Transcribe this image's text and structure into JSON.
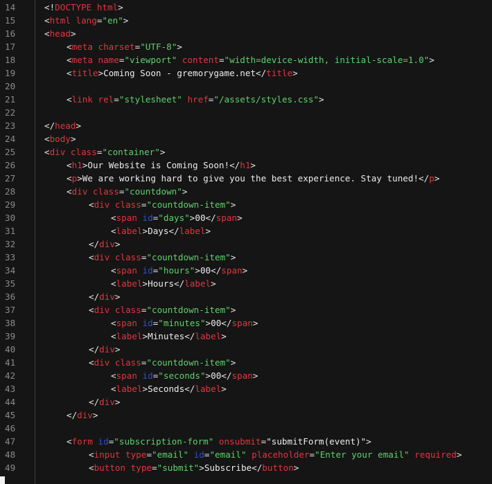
{
  "editor": {
    "background": "#151515",
    "colors": {
      "line_number": "#8b8b8b",
      "punctuation": "#e6e6e6",
      "tag": "#e0363f",
      "attribute": "#e0363f",
      "id_attribute": "#2a52c9",
      "string": "#5fd16b",
      "text": "#ececec"
    },
    "lines": [
      {
        "n": "14",
        "indent": 0,
        "tokens": [
          {
            "t": "<!",
            "k": "punct"
          },
          {
            "t": "DOCTYPE",
            "k": "tag"
          },
          {
            "t": " html",
            "k": "attr"
          },
          {
            "t": ">",
            "k": "punct"
          }
        ]
      },
      {
        "n": "15",
        "indent": 0,
        "tokens": [
          {
            "t": "<",
            "k": "punct"
          },
          {
            "t": "html",
            "k": "tag"
          },
          {
            "t": " lang",
            "k": "attr"
          },
          {
            "t": "=",
            "k": "punct"
          },
          {
            "t": "\"en\"",
            "k": "str"
          },
          {
            "t": ">",
            "k": "punct"
          }
        ]
      },
      {
        "n": "16",
        "indent": 0,
        "tokens": [
          {
            "t": "<",
            "k": "punct"
          },
          {
            "t": "head",
            "k": "tag"
          },
          {
            "t": ">",
            "k": "punct"
          }
        ]
      },
      {
        "n": "17",
        "indent": 1,
        "tokens": [
          {
            "t": "<",
            "k": "punct"
          },
          {
            "t": "meta",
            "k": "tag"
          },
          {
            "t": " charset",
            "k": "attr"
          },
          {
            "t": "=",
            "k": "punct"
          },
          {
            "t": "\"UTF-8\"",
            "k": "str"
          },
          {
            "t": ">",
            "k": "punct"
          }
        ]
      },
      {
        "n": "18",
        "indent": 1,
        "tokens": [
          {
            "t": "<",
            "k": "punct"
          },
          {
            "t": "meta",
            "k": "tag"
          },
          {
            "t": " name",
            "k": "attr"
          },
          {
            "t": "=",
            "k": "punct"
          },
          {
            "t": "\"viewport\"",
            "k": "str"
          },
          {
            "t": " content",
            "k": "attr"
          },
          {
            "t": "=",
            "k": "punct"
          },
          {
            "t": "\"width=device-width, initial-scale=1.0\"",
            "k": "str"
          },
          {
            "t": ">",
            "k": "punct"
          }
        ]
      },
      {
        "n": "19",
        "indent": 1,
        "tokens": [
          {
            "t": "<",
            "k": "punct"
          },
          {
            "t": "title",
            "k": "tag"
          },
          {
            "t": ">",
            "k": "punct"
          },
          {
            "t": "Coming Soon - gremorygame.net",
            "k": "text"
          },
          {
            "t": "</",
            "k": "punct"
          },
          {
            "t": "title",
            "k": "tag"
          },
          {
            "t": ">",
            "k": "punct"
          }
        ]
      },
      {
        "n": "20",
        "indent": 0,
        "tokens": []
      },
      {
        "n": "21",
        "indent": 1,
        "tokens": [
          {
            "t": "<",
            "k": "punct"
          },
          {
            "t": "link",
            "k": "tag"
          },
          {
            "t": " rel",
            "k": "attr"
          },
          {
            "t": "=",
            "k": "punct"
          },
          {
            "t": "\"stylesheet\"",
            "k": "str"
          },
          {
            "t": " href",
            "k": "attr"
          },
          {
            "t": "=",
            "k": "punct"
          },
          {
            "t": "\"/assets/styles.css\"",
            "k": "str"
          },
          {
            "t": ">",
            "k": "punct"
          }
        ]
      },
      {
        "n": "22",
        "indent": 0,
        "tokens": []
      },
      {
        "n": "23",
        "indent": 0,
        "tokens": [
          {
            "t": "</",
            "k": "punct"
          },
          {
            "t": "head",
            "k": "tag"
          },
          {
            "t": ">",
            "k": "punct"
          }
        ]
      },
      {
        "n": "24",
        "indent": 0,
        "tokens": [
          {
            "t": "<",
            "k": "punct"
          },
          {
            "t": "body",
            "k": "tag"
          },
          {
            "t": ">",
            "k": "punct"
          }
        ]
      },
      {
        "n": "25",
        "indent": 0,
        "tokens": [
          {
            "t": "<",
            "k": "punct"
          },
          {
            "t": "div",
            "k": "tag"
          },
          {
            "t": " class",
            "k": "attr"
          },
          {
            "t": "=",
            "k": "punct"
          },
          {
            "t": "\"container\"",
            "k": "str"
          },
          {
            "t": ">",
            "k": "punct"
          }
        ]
      },
      {
        "n": "26",
        "indent": 1,
        "tokens": [
          {
            "t": "<",
            "k": "punct"
          },
          {
            "t": "h1",
            "k": "tag"
          },
          {
            "t": ">",
            "k": "punct"
          },
          {
            "t": "Our Website is Coming Soon!",
            "k": "text"
          },
          {
            "t": "</",
            "k": "punct"
          },
          {
            "t": "h1",
            "k": "tag"
          },
          {
            "t": ">",
            "k": "punct"
          }
        ]
      },
      {
        "n": "27",
        "indent": 1,
        "tokens": [
          {
            "t": "<",
            "k": "punct"
          },
          {
            "t": "p",
            "k": "tag"
          },
          {
            "t": ">",
            "k": "punct"
          },
          {
            "t": "We are working hard to give you the best experience. Stay tuned!",
            "k": "text"
          },
          {
            "t": "</",
            "k": "punct"
          },
          {
            "t": "p",
            "k": "tag"
          },
          {
            "t": ">",
            "k": "punct"
          }
        ]
      },
      {
        "n": "28",
        "indent": 1,
        "tokens": [
          {
            "t": "<",
            "k": "punct"
          },
          {
            "t": "div",
            "k": "tag"
          },
          {
            "t": " class",
            "k": "attr"
          },
          {
            "t": "=",
            "k": "punct"
          },
          {
            "t": "\"countdown\"",
            "k": "str"
          },
          {
            "t": ">",
            "k": "punct"
          }
        ]
      },
      {
        "n": "29",
        "indent": 2,
        "tokens": [
          {
            "t": "<",
            "k": "punct"
          },
          {
            "t": "div",
            "k": "tag"
          },
          {
            "t": " class",
            "k": "attr"
          },
          {
            "t": "=",
            "k": "punct"
          },
          {
            "t": "\"countdown-item\"",
            "k": "str"
          },
          {
            "t": ">",
            "k": "punct"
          }
        ]
      },
      {
        "n": "30",
        "indent": 3,
        "tokens": [
          {
            "t": "<",
            "k": "punct"
          },
          {
            "t": "span",
            "k": "tag"
          },
          {
            "t": " id",
            "k": "attr-id"
          },
          {
            "t": "=",
            "k": "punct"
          },
          {
            "t": "\"days\"",
            "k": "str"
          },
          {
            "t": ">",
            "k": "punct"
          },
          {
            "t": "00",
            "k": "text"
          },
          {
            "t": "</",
            "k": "punct"
          },
          {
            "t": "span",
            "k": "tag"
          },
          {
            "t": ">",
            "k": "punct"
          }
        ]
      },
      {
        "n": "31",
        "indent": 3,
        "tokens": [
          {
            "t": "<",
            "k": "punct"
          },
          {
            "t": "label",
            "k": "tag"
          },
          {
            "t": ">",
            "k": "punct"
          },
          {
            "t": "Days",
            "k": "text"
          },
          {
            "t": "</",
            "k": "punct"
          },
          {
            "t": "label",
            "k": "tag"
          },
          {
            "t": ">",
            "k": "punct"
          }
        ]
      },
      {
        "n": "32",
        "indent": 2,
        "tokens": [
          {
            "t": "</",
            "k": "punct"
          },
          {
            "t": "div",
            "k": "tag"
          },
          {
            "t": ">",
            "k": "punct"
          }
        ]
      },
      {
        "n": "33",
        "indent": 2,
        "tokens": [
          {
            "t": "<",
            "k": "punct"
          },
          {
            "t": "div",
            "k": "tag"
          },
          {
            "t": " class",
            "k": "attr"
          },
          {
            "t": "=",
            "k": "punct"
          },
          {
            "t": "\"countdown-item\"",
            "k": "str"
          },
          {
            "t": ">",
            "k": "punct"
          }
        ]
      },
      {
        "n": "34",
        "indent": 3,
        "tokens": [
          {
            "t": "<",
            "k": "punct"
          },
          {
            "t": "span",
            "k": "tag"
          },
          {
            "t": " id",
            "k": "attr-id"
          },
          {
            "t": "=",
            "k": "punct"
          },
          {
            "t": "\"hours\"",
            "k": "str"
          },
          {
            "t": ">",
            "k": "punct"
          },
          {
            "t": "00",
            "k": "text"
          },
          {
            "t": "</",
            "k": "punct"
          },
          {
            "t": "span",
            "k": "tag"
          },
          {
            "t": ">",
            "k": "punct"
          }
        ]
      },
      {
        "n": "35",
        "indent": 3,
        "tokens": [
          {
            "t": "<",
            "k": "punct"
          },
          {
            "t": "label",
            "k": "tag"
          },
          {
            "t": ">",
            "k": "punct"
          },
          {
            "t": "Hours",
            "k": "text"
          },
          {
            "t": "</",
            "k": "punct"
          },
          {
            "t": "label",
            "k": "tag"
          },
          {
            "t": ">",
            "k": "punct"
          }
        ]
      },
      {
        "n": "36",
        "indent": 2,
        "tokens": [
          {
            "t": "</",
            "k": "punct"
          },
          {
            "t": "div",
            "k": "tag"
          },
          {
            "t": ">",
            "k": "punct"
          }
        ]
      },
      {
        "n": "37",
        "indent": 2,
        "tokens": [
          {
            "t": "<",
            "k": "punct"
          },
          {
            "t": "div",
            "k": "tag"
          },
          {
            "t": " class",
            "k": "attr"
          },
          {
            "t": "=",
            "k": "punct"
          },
          {
            "t": "\"countdown-item\"",
            "k": "str"
          },
          {
            "t": ">",
            "k": "punct"
          }
        ]
      },
      {
        "n": "38",
        "indent": 3,
        "tokens": [
          {
            "t": "<",
            "k": "punct"
          },
          {
            "t": "span",
            "k": "tag"
          },
          {
            "t": " id",
            "k": "attr-id"
          },
          {
            "t": "=",
            "k": "punct"
          },
          {
            "t": "\"minutes\"",
            "k": "str"
          },
          {
            "t": ">",
            "k": "punct"
          },
          {
            "t": "00",
            "k": "text"
          },
          {
            "t": "</",
            "k": "punct"
          },
          {
            "t": "span",
            "k": "tag"
          },
          {
            "t": ">",
            "k": "punct"
          }
        ]
      },
      {
        "n": "39",
        "indent": 3,
        "tokens": [
          {
            "t": "<",
            "k": "punct"
          },
          {
            "t": "label",
            "k": "tag"
          },
          {
            "t": ">",
            "k": "punct"
          },
          {
            "t": "Minutes",
            "k": "text"
          },
          {
            "t": "</",
            "k": "punct"
          },
          {
            "t": "label",
            "k": "tag"
          },
          {
            "t": ">",
            "k": "punct"
          }
        ]
      },
      {
        "n": "40",
        "indent": 2,
        "tokens": [
          {
            "t": "</",
            "k": "punct"
          },
          {
            "t": "div",
            "k": "tag"
          },
          {
            "t": ">",
            "k": "punct"
          }
        ]
      },
      {
        "n": "41",
        "indent": 2,
        "tokens": [
          {
            "t": "<",
            "k": "punct"
          },
          {
            "t": "div",
            "k": "tag"
          },
          {
            "t": " class",
            "k": "attr"
          },
          {
            "t": "=",
            "k": "punct"
          },
          {
            "t": "\"countdown-item\"",
            "k": "str"
          },
          {
            "t": ">",
            "k": "punct"
          }
        ]
      },
      {
        "n": "42",
        "indent": 3,
        "tokens": [
          {
            "t": "<",
            "k": "punct"
          },
          {
            "t": "span",
            "k": "tag"
          },
          {
            "t": " id",
            "k": "attr-id"
          },
          {
            "t": "=",
            "k": "punct"
          },
          {
            "t": "\"seconds\"",
            "k": "str"
          },
          {
            "t": ">",
            "k": "punct"
          },
          {
            "t": "00",
            "k": "text"
          },
          {
            "t": "</",
            "k": "punct"
          },
          {
            "t": "span",
            "k": "tag"
          },
          {
            "t": ">",
            "k": "punct"
          }
        ]
      },
      {
        "n": "43",
        "indent": 3,
        "tokens": [
          {
            "t": "<",
            "k": "punct"
          },
          {
            "t": "label",
            "k": "tag"
          },
          {
            "t": ">",
            "k": "punct"
          },
          {
            "t": "Seconds",
            "k": "text"
          },
          {
            "t": "</",
            "k": "punct"
          },
          {
            "t": "label",
            "k": "tag"
          },
          {
            "t": ">",
            "k": "punct"
          }
        ]
      },
      {
        "n": "44",
        "indent": 2,
        "tokens": [
          {
            "t": "</",
            "k": "punct"
          },
          {
            "t": "div",
            "k": "tag"
          },
          {
            "t": ">",
            "k": "punct"
          }
        ]
      },
      {
        "n": "45",
        "indent": 1,
        "tokens": [
          {
            "t": "</",
            "k": "punct"
          },
          {
            "t": "div",
            "k": "tag"
          },
          {
            "t": ">",
            "k": "punct"
          }
        ]
      },
      {
        "n": "46",
        "indent": 0,
        "tokens": []
      },
      {
        "n": "47",
        "indent": 1,
        "tokens": [
          {
            "t": "<",
            "k": "punct"
          },
          {
            "t": "form",
            "k": "tag"
          },
          {
            "t": " id",
            "k": "attr-id"
          },
          {
            "t": "=",
            "k": "punct"
          },
          {
            "t": "\"subscription-form\"",
            "k": "str"
          },
          {
            "t": " onsubmit",
            "k": "attr"
          },
          {
            "t": "=",
            "k": "punct"
          },
          {
            "t": "\"submitForm(event)\"",
            "k": "text"
          },
          {
            "t": ">",
            "k": "punct"
          }
        ]
      },
      {
        "n": "48",
        "indent": 2,
        "tokens": [
          {
            "t": "<",
            "k": "punct"
          },
          {
            "t": "input",
            "k": "tag"
          },
          {
            "t": " type",
            "k": "attr"
          },
          {
            "t": "=",
            "k": "punct"
          },
          {
            "t": "\"email\"",
            "k": "str"
          },
          {
            "t": " id",
            "k": "attr-id"
          },
          {
            "t": "=",
            "k": "punct"
          },
          {
            "t": "\"email\"",
            "k": "str"
          },
          {
            "t": " placeholder",
            "k": "attr"
          },
          {
            "t": "=",
            "k": "punct"
          },
          {
            "t": "\"Enter your email\"",
            "k": "str"
          },
          {
            "t": " required",
            "k": "attr"
          },
          {
            "t": ">",
            "k": "punct"
          }
        ]
      },
      {
        "n": "49",
        "indent": 2,
        "tokens": [
          {
            "t": "<",
            "k": "punct"
          },
          {
            "t": "button",
            "k": "tag"
          },
          {
            "t": " type",
            "k": "attr"
          },
          {
            "t": "=",
            "k": "punct"
          },
          {
            "t": "\"submit\"",
            "k": "str"
          },
          {
            "t": ">",
            "k": "punct"
          },
          {
            "t": "Subscribe",
            "k": "text"
          },
          {
            "t": "</",
            "k": "punct"
          },
          {
            "t": "button",
            "k": "tag"
          },
          {
            "t": ">",
            "k": "punct"
          }
        ]
      }
    ]
  }
}
